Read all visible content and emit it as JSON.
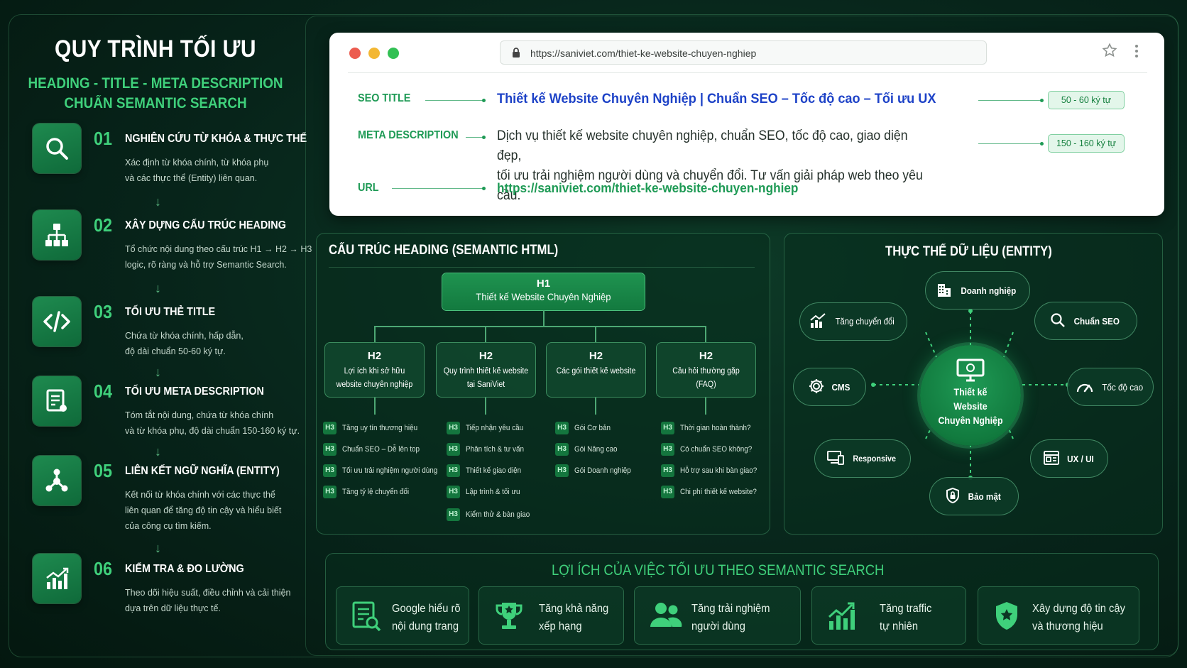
{
  "left": {
    "title": "QUY TRÌNH TỐI ƯU",
    "subtitle_1": "HEADING - TITLE - META DESCRIPTION",
    "subtitle_2": "CHUẨN SEMANTIC SEARCH",
    "steps": [
      {
        "num": "01",
        "title": "NGHIÊN CỨU TỪ KHÓA & THỰC THỂ",
        "desc": "Xác định từ khóa chính, từ khóa phụ\nvà các thực thể (Entity) liên quan.",
        "icon": "search-icon"
      },
      {
        "num": "02",
        "title": "XÂY DỰNG CẤU TRÚC HEADING",
        "desc": "Tổ chức nội dung theo cấu trúc H1 → H2 → H3\nlogic, rõ ràng và hỗ trợ Semantic Search.",
        "icon": "hierarchy-icon"
      },
      {
        "num": "03",
        "title": "TỐI ƯU THẺ TITLE",
        "desc": "Chứa từ khóa chính, hấp dẫn,\nđộ dài chuẩn 50-60 ký tự.",
        "icon": "code-icon"
      },
      {
        "num": "04",
        "title": "TỐI ƯU META DESCRIPTION",
        "desc": "Tóm tắt nội dung, chứa từ khóa chính\nvà từ khóa phụ, độ dài chuẩn 150-160 ký tự.",
        "icon": "document-icon"
      },
      {
        "num": "05",
        "title": "LIÊN KẾT NGỮ NGHĨA (ENTITY)",
        "desc": "Kết nối từ khóa chính với các thực thể\nliên quan để tăng độ tin cậy và hiểu biết\ncủa công cụ tìm kiếm.",
        "icon": "network-icon"
      },
      {
        "num": "06",
        "title": "KIỂM TRA & ĐO LƯỜNG",
        "desc": "Theo dõi hiệu suất, điều chỉnh và cải thiện\ndựa trên dữ liệu thực tế.",
        "icon": "chart-icon"
      }
    ]
  },
  "browser": {
    "url": "https://saniviet.com/thiet-ke-website-chuyen-nghiep",
    "seo_title_label": "SEO TITLE",
    "seo_title_value": "Thiết kế Website Chuyên Nghiệp | Chuẩn SEO – Tốc độ cao – Tối ưu UX",
    "seo_title_pill": "50 - 60 ký tự",
    "meta_label": "META DESCRIPTION",
    "meta_value": "Dịch vụ thiết kế website chuyên nghiệp, chuẩn SEO, tốc độ cao, giao diện đẹp,\ntối ưu trải nghiệm người dùng và chuyển đổi. Tư vấn giải pháp web theo yêu cầu.",
    "meta_pill": "150 - 160 ký tự",
    "url_label": "URL",
    "url_value": "https://saniviet.com/thiet-ke-website-chuyen-nghiep"
  },
  "heading": {
    "title": "CẤU TRÚC HEADING (SEMANTIC HTML)",
    "h1": {
      "tag": "H1",
      "text": "Thiết kế Website Chuyên Nghiệp"
    },
    "h2": [
      {
        "tag": "H2",
        "text": "Lợi ích khi sở hữu website chuyên nghiệp",
        "h3": [
          "Tăng uy tín thương hiệu",
          "Chuẩn SEO – Dễ lên top",
          "Tối ưu trải nghiệm người dùng",
          "Tăng tỷ lệ chuyển đổi"
        ]
      },
      {
        "tag": "H2",
        "text": "Quy trình thiết kế website tại SaniViet",
        "h3": [
          "Tiếp nhận yêu cầu",
          "Phân tích & tư vấn",
          "Thiết kế giao diện",
          "Lập trình & tối ưu",
          "Kiểm thử & bàn giao"
        ]
      },
      {
        "tag": "H2",
        "text": "Các gói thiết kế website",
        "h3": [
          "Gói Cơ bản",
          "Gói Nâng cao",
          "Gói Doanh nghiệp"
        ]
      },
      {
        "tag": "H2",
        "text": "Câu hỏi thường gặp (FAQ)",
        "h3": [
          "Thời gian hoàn thành?",
          "Có chuẩn SEO không?",
          "Hỗ trợ sau khi bàn giao?",
          "Chi phí thiết kế website?"
        ]
      }
    ],
    "h3_tag": "H3"
  },
  "entity": {
    "title": "THỰC THỂ DỮ LIỆU (ENTITY)",
    "center": "Thiết kế\nWebsite\nChuyên Nghiệp",
    "nodes": {
      "doanh_nghiep": "Doanh nghiệp",
      "tang_chuyen_doi": "Tăng chuyển đổi",
      "chuan_seo": "Chuẩn SEO",
      "cms": "CMS",
      "toc_do_cao": "Tốc độ cao",
      "responsive": "Responsive",
      "ux_ui": "UX / UI",
      "bao_mat": "Bảo mật"
    }
  },
  "benefits": {
    "title": "LỢI ÍCH CỦA VIỆC TỐI ƯU THEO SEMANTIC SEARCH",
    "items": [
      {
        "text": "Google hiểu rõ\nnội dung trang",
        "icon": "document-search-icon"
      },
      {
        "text": "Tăng khả năng\nxếp hạng",
        "icon": "trophy-icon"
      },
      {
        "text": "Tăng trải nghiệm\nngười dùng",
        "icon": "users-icon"
      },
      {
        "text": "Tăng traffic\ntự nhiên",
        "icon": "growth-chart-icon"
      },
      {
        "text": "Xây dựng độ tin cậy\nvà thương hiệu",
        "icon": "shield-icon"
      }
    ]
  },
  "colors": {
    "accent": "#3fd07b",
    "background": "#07241a",
    "title_blue": "#1d42c7",
    "link_green": "#1e9a55"
  }
}
